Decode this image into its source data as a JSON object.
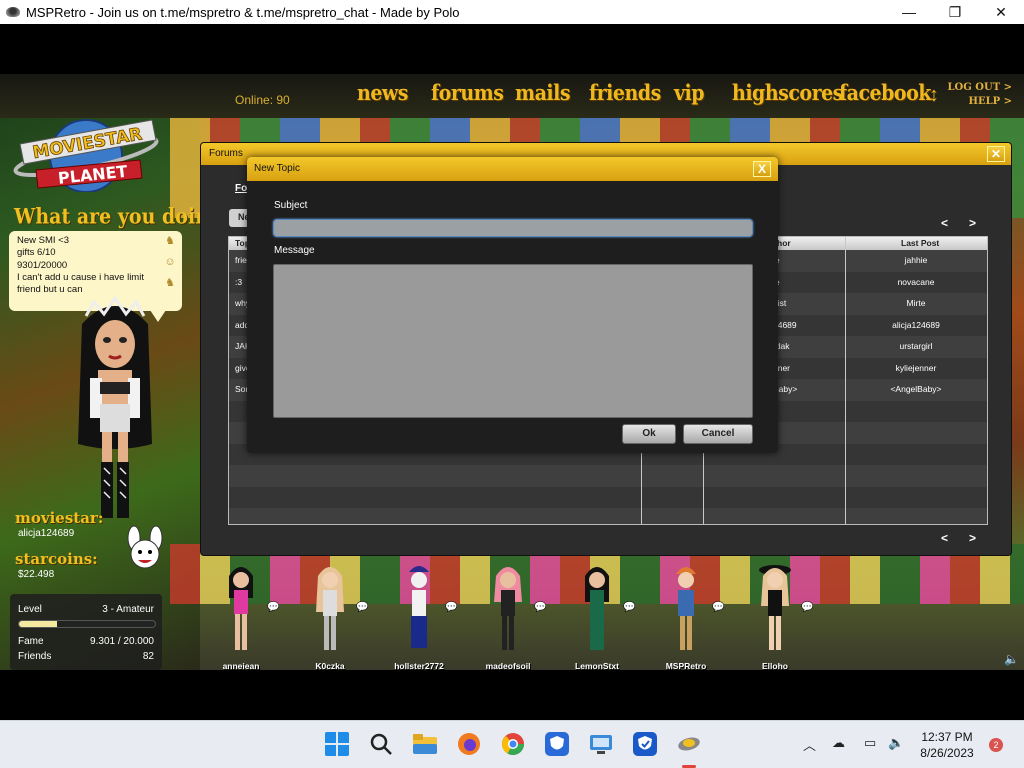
{
  "window": {
    "title": "MSPRetro - Join us on t.me/mspretro & t.me/mspretro_chat - Made by Polo",
    "buttons": {
      "minimize": "—",
      "maximize": "❐",
      "close": "✕"
    }
  },
  "topnav": {
    "online": "Online: 90",
    "items": [
      "news",
      "forums",
      "mails",
      "friends",
      "vip",
      "highscores",
      "facebook"
    ],
    "updown": "↕",
    "logout": "LOG OUT >",
    "help": "HELP >"
  },
  "logo": {
    "line1": "MOVIESTAR",
    "line2": "PLANET"
  },
  "status": {
    "title": "What are you doing?",
    "lines": [
      "New SMI <3",
      "gifts 6/10",
      "9301/20000",
      "I can't add u cause i have limit",
      "friend but u can"
    ]
  },
  "profile": {
    "moviestar_label": "moviestar:",
    "moviestar_name": "alicja124689",
    "starcoins_label": "starcoins:",
    "starcoins_value": "$22.498"
  },
  "stats": {
    "level_label": "Level",
    "level_value": "3 - Amateur",
    "level_progress": 0.28,
    "fame_label": "Fame",
    "fame_value": "9.301 / 20.000",
    "friends_label": "Friends",
    "friends_value": "82"
  },
  "forums": {
    "title": "Forums",
    "tab": "Fo",
    "new_button": "Ne",
    "pager_prev": "<",
    "pager_next": ">",
    "columns": {
      "topic": "Top",
      "author": "hor",
      "last_post": "Last Post"
    },
    "rows": [
      {
        "topic": "frie",
        "author": "ie",
        "last_post": "jahhie"
      },
      {
        "topic": ":3",
        "author": "ie",
        "last_post": "novacane"
      },
      {
        "topic": "why",
        "author": "nist",
        "last_post": "Mirte"
      },
      {
        "topic": "add",
        "author": "24689",
        "last_post": "alicja124689"
      },
      {
        "topic": "JAK",
        "author": "rdak",
        "last_post": "urstargirl"
      },
      {
        "topic": "give",
        "author": "nner",
        "last_post": "kyliejenner"
      },
      {
        "topic": "Sor",
        "author": "Baby>",
        "last_post": "<AngelBaby>"
      }
    ]
  },
  "dialog": {
    "title": "New Topic",
    "close": "X",
    "subject_label": "Subject",
    "subject_value": "",
    "message_label": "Message",
    "message_value": "",
    "ok": "Ok",
    "cancel": "Cancel"
  },
  "avatars": [
    "anneiean",
    "K0czka",
    "hollster2772",
    "madeofsoil",
    "LemonStxt",
    "MSPRetro",
    "Elloho"
  ],
  "taskbar": {
    "time": "12:37 PM",
    "date": "8/26/2023",
    "notifications": "2",
    "icons": [
      "windows-start-icon",
      "search-icon",
      "file-explorer-icon",
      "firefox-icon",
      "chrome-icon",
      "vpn-shield-icon",
      "remote-desktop-icon",
      "shield-app-icon",
      "mspretro-icon"
    ]
  }
}
